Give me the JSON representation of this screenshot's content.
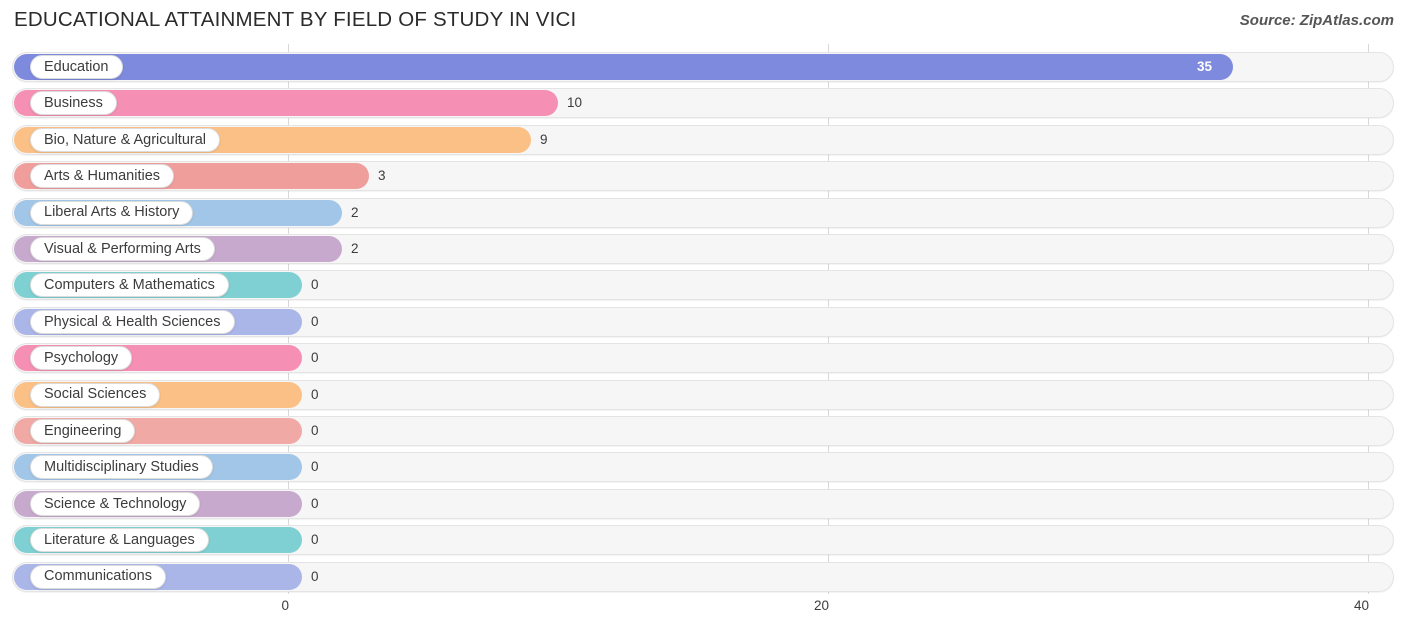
{
  "header": {
    "title": "EDUCATIONAL ATTAINMENT BY FIELD OF STUDY IN VICI",
    "source": "Source: ZipAtlas.com"
  },
  "chart_data": {
    "type": "bar",
    "orientation": "horizontal",
    "title": "EDUCATIONAL ATTAINMENT BY FIELD OF STUDY IN VICI",
    "xlabel": "",
    "ylabel": "",
    "xlim": [
      0,
      40
    ],
    "xticks": [
      "0",
      "20",
      "40"
    ],
    "grid": true,
    "legend": false,
    "categories": [
      "Education",
      "Business",
      "Bio, Nature & Agricultural",
      "Arts & Humanities",
      "Liberal Arts & History",
      "Visual & Performing Arts",
      "Computers & Mathematics",
      "Physical & Health Sciences",
      "Psychology",
      "Social Sciences",
      "Engineering",
      "Multidisciplinary Studies",
      "Science & Technology",
      "Literature & Languages",
      "Communications"
    ],
    "values": [
      35,
      10,
      9,
      3,
      2,
      2,
      0,
      0,
      0,
      0,
      0,
      0,
      0,
      0,
      0
    ],
    "value_labels": [
      "35",
      "10",
      "9",
      "3",
      "2",
      "2",
      "0",
      "0",
      "0",
      "0",
      "0",
      "0",
      "0",
      "0",
      "0"
    ],
    "colors": [
      "#7d8ade",
      "#f58fb4",
      "#fbc086",
      "#f09e9b",
      "#a2c6e8",
      "#c7a9ce",
      "#7fd0d3",
      "#aab5e8",
      "#f58fb4",
      "#fbc086",
      "#f0a9a4",
      "#a2c6e8",
      "#c7a9ce",
      "#7fd0d3",
      "#aab5e8"
    ]
  }
}
